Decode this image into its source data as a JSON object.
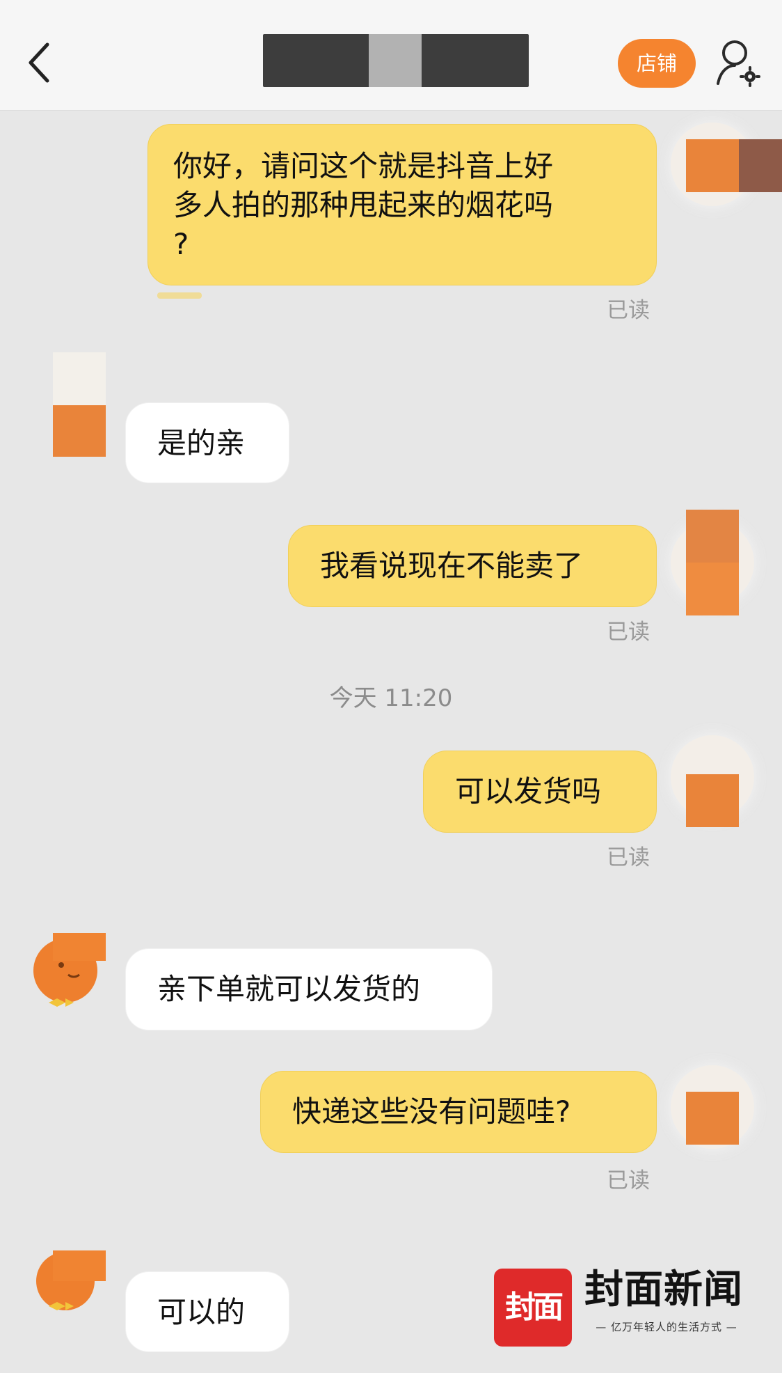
{
  "header": {
    "back_icon": "chevron-left-icon",
    "title": "",
    "store_button_label": "店铺",
    "user_settings_icon": "user-settings-icon"
  },
  "messages": [
    {
      "direction": "outgoing",
      "text": "你好，请问这个就是抖音上好\n多人拍的那种甩起来的烟花吗\n?",
      "status": "已读"
    },
    {
      "direction": "incoming",
      "text": "是的亲"
    },
    {
      "direction": "outgoing",
      "text": "我看说现在不能卖了",
      "status": "已读"
    },
    {
      "direction": "outgoing",
      "text": "可以发货吗",
      "status": "已读"
    },
    {
      "direction": "incoming",
      "text": "亲下单就可以发货的"
    },
    {
      "direction": "outgoing",
      "text": "快递这些没有问题哇?",
      "status": "已读"
    },
    {
      "direction": "incoming",
      "text": "可以的"
    }
  ],
  "timestamp": "今天 11:20",
  "watermark": {
    "mark": "封面",
    "name": "封面新闻",
    "tagline": "— 亿万年轻人的生活方式 —"
  },
  "colors": {
    "outgoing_bubble": "#fbdc6d",
    "incoming_bubble": "#ffffff",
    "store_button": "#f5842f",
    "chat_background": "#e7e7e7",
    "brand_red": "#df2a2a"
  }
}
